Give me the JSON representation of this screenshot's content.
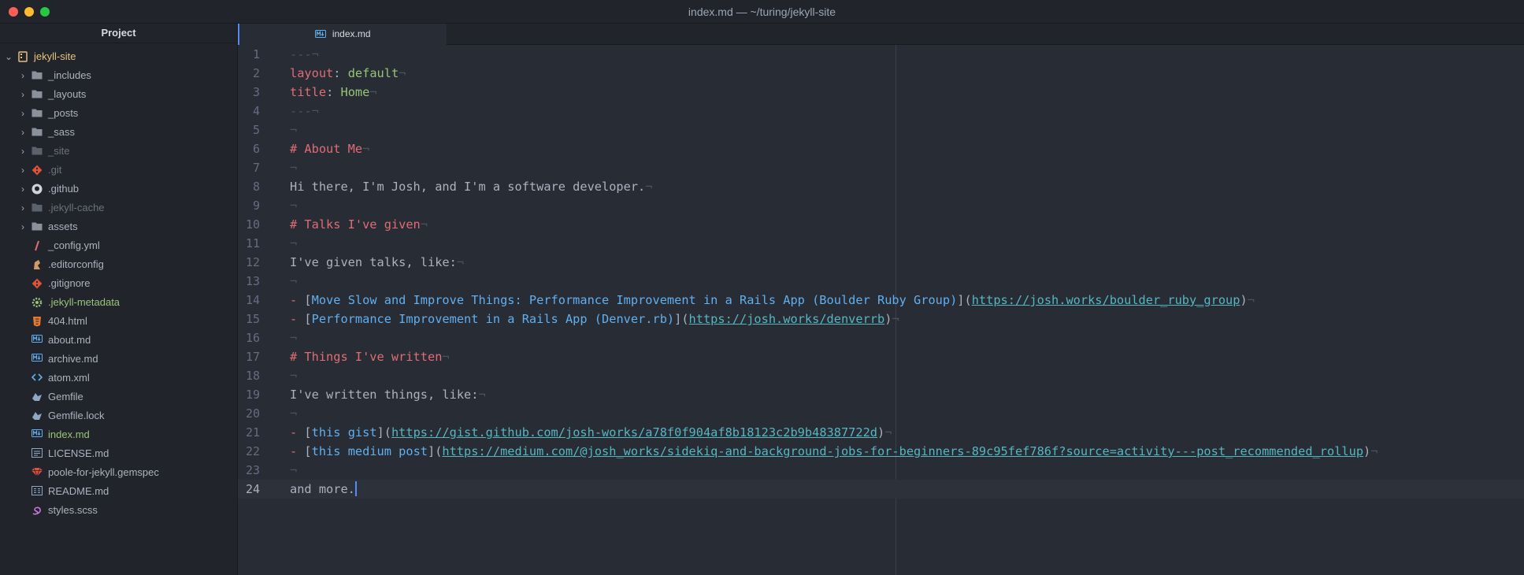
{
  "window": {
    "title": "index.md — ~/turing/jekyll-site"
  },
  "sidebar": {
    "header": "Project",
    "root": {
      "label": "jekyll-site"
    },
    "items": [
      {
        "label": "_includes",
        "type": "folder",
        "state": "normal"
      },
      {
        "label": "_layouts",
        "type": "folder",
        "state": "normal"
      },
      {
        "label": "_posts",
        "type": "folder",
        "state": "normal"
      },
      {
        "label": "_sass",
        "type": "folder",
        "state": "normal"
      },
      {
        "label": "_site",
        "type": "folder",
        "state": "ignored"
      },
      {
        "label": ".git",
        "type": "git-folder",
        "state": "ignored"
      },
      {
        "label": ".github",
        "type": "github-folder",
        "state": "normal"
      },
      {
        "label": ".jekyll-cache",
        "type": "folder",
        "state": "ignored"
      },
      {
        "label": "assets",
        "type": "folder",
        "state": "normal"
      },
      {
        "label": "_config.yml",
        "type": "file",
        "icon": "yaml-icon"
      },
      {
        "label": ".editorconfig",
        "type": "file",
        "icon": "editorconfig-icon"
      },
      {
        "label": ".gitignore",
        "type": "file",
        "icon": "git-icon"
      },
      {
        "label": ".jekyll-metadata",
        "type": "file",
        "icon": "gear-icon",
        "state": "new"
      },
      {
        "label": "404.html",
        "type": "file",
        "icon": "html5-icon"
      },
      {
        "label": "about.md",
        "type": "file",
        "icon": "markdown-icon"
      },
      {
        "label": "archive.md",
        "type": "file",
        "icon": "markdown-icon"
      },
      {
        "label": "atom.xml",
        "type": "file",
        "icon": "code-icon"
      },
      {
        "label": "Gemfile",
        "type": "file",
        "icon": "bundler-icon"
      },
      {
        "label": "Gemfile.lock",
        "type": "file",
        "icon": "bundler-icon"
      },
      {
        "label": "index.md",
        "type": "file",
        "icon": "markdown-icon",
        "state": "active"
      },
      {
        "label": "LICENSE.md",
        "type": "file",
        "icon": "license-icon"
      },
      {
        "label": "poole-for-jekyll.gemspec",
        "type": "file",
        "icon": "ruby-gem-icon"
      },
      {
        "label": "README.md",
        "type": "file",
        "icon": "readme-icon"
      },
      {
        "label": "styles.scss",
        "type": "file",
        "icon": "sass-icon"
      }
    ]
  },
  "tabs": [
    {
      "label": "index.md",
      "icon": "markdown-icon",
      "active": true
    }
  ],
  "editor": {
    "invisible_eol": "¬",
    "lines": [
      {
        "n": "1",
        "parts": [
          [
            "inv",
            "---¬"
          ]
        ]
      },
      {
        "n": "2",
        "parts": [
          [
            "key",
            "layout"
          ],
          [
            "txt",
            ": "
          ],
          [
            "str",
            "default"
          ],
          [
            "inv",
            "¬"
          ]
        ]
      },
      {
        "n": "3",
        "parts": [
          [
            "key",
            "title"
          ],
          [
            "txt",
            ": "
          ],
          [
            "str",
            "Home"
          ],
          [
            "inv",
            "¬"
          ]
        ]
      },
      {
        "n": "4",
        "parts": [
          [
            "inv",
            "---¬"
          ]
        ]
      },
      {
        "n": "5",
        "parts": [
          [
            "inv",
            "¬"
          ]
        ]
      },
      {
        "n": "6",
        "parts": [
          [
            "hd",
            "# About Me"
          ],
          [
            "inv",
            "¬"
          ]
        ]
      },
      {
        "n": "7",
        "parts": [
          [
            "inv",
            "¬"
          ]
        ]
      },
      {
        "n": "8",
        "parts": [
          [
            "txt",
            "Hi there, I'm Josh, and I'm a software developer."
          ],
          [
            "inv",
            "¬"
          ]
        ]
      },
      {
        "n": "9",
        "parts": [
          [
            "inv",
            "¬"
          ]
        ]
      },
      {
        "n": "10",
        "parts": [
          [
            "hd",
            "# Talks I've given"
          ],
          [
            "inv",
            "¬"
          ]
        ]
      },
      {
        "n": "11",
        "parts": [
          [
            "inv",
            "¬"
          ]
        ]
      },
      {
        "n": "12",
        "parts": [
          [
            "txt",
            "I've given talks, like:"
          ],
          [
            "inv",
            "¬"
          ]
        ]
      },
      {
        "n": "13",
        "parts": [
          [
            "inv",
            "¬"
          ]
        ]
      },
      {
        "n": "14",
        "parts": [
          [
            "key",
            "- "
          ],
          [
            "txt",
            "["
          ],
          [
            "lk",
            "Move Slow and Improve Things: Performance Improvement in a Rails App (Boulder Ruby Group)"
          ],
          [
            "txt",
            "]("
          ],
          [
            "url",
            "https://josh.works/boulder_ruby_group"
          ],
          [
            "txt",
            ")"
          ],
          [
            "inv",
            "¬"
          ]
        ]
      },
      {
        "n": "15",
        "parts": [
          [
            "key",
            "- "
          ],
          [
            "txt",
            "["
          ],
          [
            "lk",
            "Performance Improvement in a Rails App (Denver.rb)"
          ],
          [
            "txt",
            "]("
          ],
          [
            "url",
            "https://josh.works/denverrb"
          ],
          [
            "txt",
            ")"
          ],
          [
            "inv",
            "¬"
          ]
        ]
      },
      {
        "n": "16",
        "parts": [
          [
            "inv",
            "¬"
          ]
        ]
      },
      {
        "n": "17",
        "parts": [
          [
            "hd",
            "# Things I've written"
          ],
          [
            "inv",
            "¬"
          ]
        ]
      },
      {
        "n": "18",
        "parts": [
          [
            "inv",
            "¬"
          ]
        ]
      },
      {
        "n": "19",
        "parts": [
          [
            "txt",
            "I've written things, like:"
          ],
          [
            "inv",
            "¬"
          ]
        ]
      },
      {
        "n": "20",
        "parts": [
          [
            "inv",
            "¬"
          ]
        ]
      },
      {
        "n": "21",
        "parts": [
          [
            "key",
            "- "
          ],
          [
            "txt",
            "["
          ],
          [
            "lk",
            "this gist"
          ],
          [
            "txt",
            "]("
          ],
          [
            "url",
            "https://gist.github.com/josh-works/a78f0f904af8b18123c2b9b48387722d"
          ],
          [
            "txt",
            ")"
          ],
          [
            "inv",
            "¬"
          ]
        ]
      },
      {
        "n": "22",
        "parts": [
          [
            "key",
            "- "
          ],
          [
            "txt",
            "["
          ],
          [
            "lk",
            "this medium post"
          ],
          [
            "txt",
            "]("
          ],
          [
            "url",
            "https://medium.com/@josh_works/sidekiq-and-background-jobs-for-beginners-89c95fef786f?source=activity---post_recommended_rollup"
          ],
          [
            "txt",
            ")"
          ],
          [
            "inv",
            "¬"
          ]
        ]
      },
      {
        "n": "23",
        "parts": [
          [
            "inv",
            "¬"
          ]
        ]
      },
      {
        "n": "24",
        "parts": [
          [
            "txt",
            "and more."
          ]
        ],
        "cursor": true
      }
    ]
  },
  "colors": {
    "accent": "#568af2",
    "keyword": "#e06c75",
    "string": "#98c379",
    "link": "#61afef",
    "url": "#56b6c2",
    "folder_root": "#e5c07b"
  }
}
